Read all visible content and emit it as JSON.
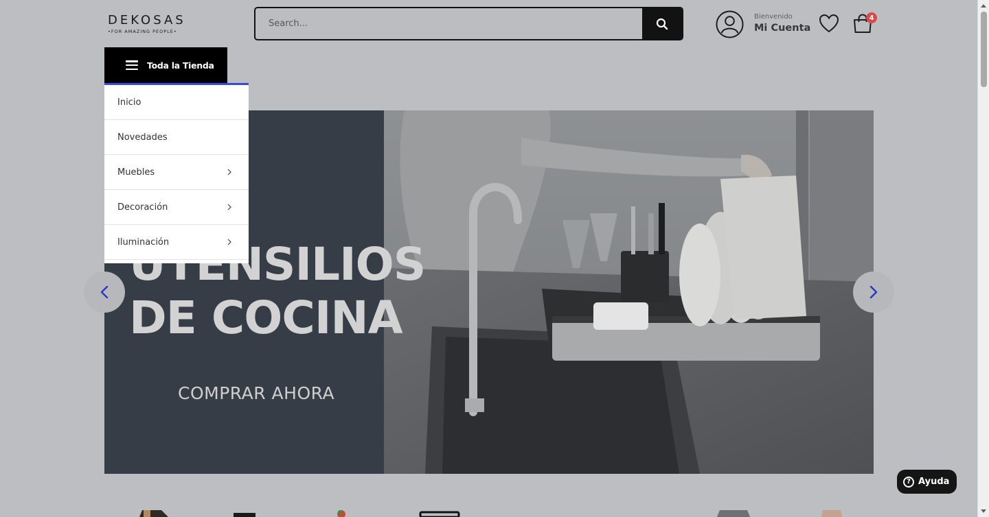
{
  "brand": {
    "name": "DEKOSAS",
    "tagline": "•FOR AMAZING PEOPLE•"
  },
  "search": {
    "placeholder": "Search..."
  },
  "account": {
    "greeting": "Bienvenido",
    "label": "Mi Cuenta"
  },
  "cart": {
    "count": "4"
  },
  "store_button": {
    "label": "Toda la Tienda"
  },
  "menu": {
    "items": [
      {
        "label": "Inicio",
        "has_submenu": false
      },
      {
        "label": "Novedades",
        "has_submenu": false
      },
      {
        "label": "Muebles",
        "has_submenu": true
      },
      {
        "label": "Decoración",
        "has_submenu": true
      },
      {
        "label": "Iluminación",
        "has_submenu": true
      }
    ]
  },
  "hero": {
    "headline_line1": "UTENSILIOS",
    "headline_line2": "DE COCINA",
    "cta": "COMPRAR AHORA"
  },
  "help": {
    "label": "Ayuda"
  },
  "colors": {
    "accent": "#3a4ad8",
    "arrow": "#2b37c6",
    "badge": "#d94b4b",
    "overlay": "#bdbec1"
  },
  "icons": {
    "search": "search-icon",
    "account": "user-circle-icon",
    "wishlist": "heart-icon",
    "cart": "shopping-bag-icon",
    "menu": "hamburger-icon",
    "chevron": "chevron-right-icon",
    "help": "question-circle-icon"
  }
}
